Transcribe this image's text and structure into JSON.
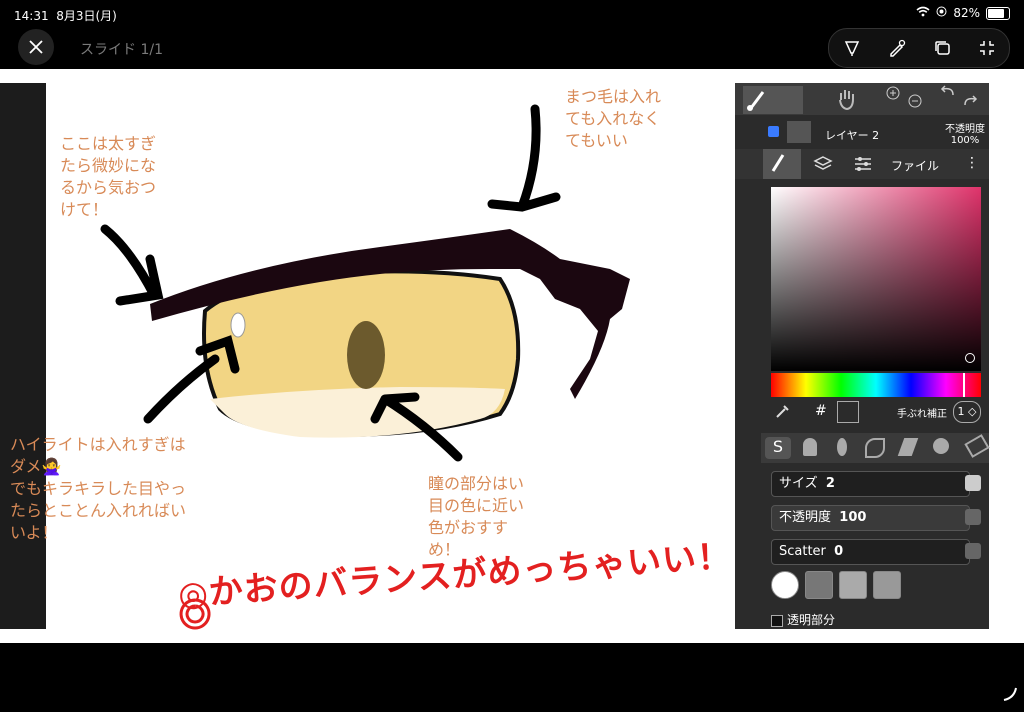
{
  "status": {
    "time": "14:31",
    "date": "8月3日(月)",
    "battery": "82%",
    "battery_level": 0.82
  },
  "topbar": {
    "slide_label": "スライド 1/1",
    "close_icon": "close-icon",
    "tools": [
      "pen-select-icon",
      "pen-settings-icon",
      "duplicate-icon",
      "exit-fullscreen-icon"
    ]
  },
  "slide": {
    "notes": {
      "thickness": "ここは太すぎ\nたら微妙にな\nるから気おつ\nけて！",
      "lashes": "まつ毛は入れ\nても入れなく\nてもいい",
      "highlight_a": "ハイライトは入れすぎは\nダメ🙅‍♀️\nでもキラキラした目やっ\nたらとことん入れればい\nいよ！",
      "pupil": "瞳の部分はい\n目の色に近い\n色がおすす\nめ！"
    },
    "praise": "◎かおのバランスがめっちゃいい！"
  },
  "panel": {
    "layer_name": "レイヤー 2",
    "opacity_label": "不透明度",
    "opacity_value": "100%",
    "file_label": "ファイル",
    "hash": "#",
    "stabilizer_label": "手ぶれ補正",
    "stabilizer_value": "1",
    "size_label": "サイズ",
    "size_value": "2",
    "brush_opacity_label": "不透明度",
    "brush_opacity_value": "100",
    "scatter_label": "Scatter",
    "scatter_value": "0",
    "transparent_label": "透明部分",
    "colors": {
      "current": "#ffffff",
      "gradient_hue": "#e0336b"
    }
  }
}
